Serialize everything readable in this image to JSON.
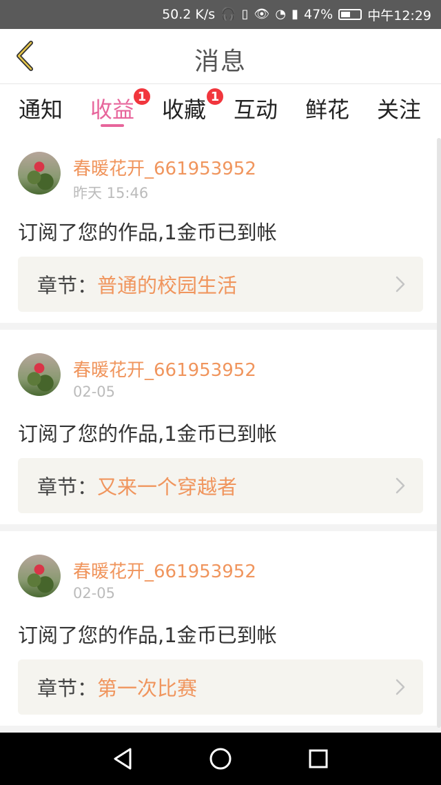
{
  "status_bar": {
    "network_speed": "50.2 K/s",
    "battery": "47%",
    "time": "中午12:29"
  },
  "header": {
    "title": "消息"
  },
  "tabs": [
    {
      "label": "通知",
      "badge": ""
    },
    {
      "label": "收益",
      "badge": "1"
    },
    {
      "label": "收藏",
      "badge": "1"
    },
    {
      "label": "互动",
      "badge": ""
    },
    {
      "label": "鲜花",
      "badge": ""
    },
    {
      "label": "关注",
      "badge": ""
    }
  ],
  "active_tab": "收益",
  "colors": {
    "accent_pink": "#e7659b",
    "name_orange": "#f0955d",
    "badge_red": "#f1363d"
  },
  "messages": [
    {
      "username": "春暖花开_661953952",
      "time": "昨天 15:46",
      "text": "订阅了您的作品,1金币已到帐",
      "chapter_prefix": "章节：",
      "chapter_name": "普通的校园生活"
    },
    {
      "username": "春暖花开_661953952",
      "time": "02-05",
      "text": "订阅了您的作品,1金币已到帐",
      "chapter_prefix": "章节：",
      "chapter_name": "又来一个穿越者"
    },
    {
      "username": "春暖花开_661953952",
      "time": "02-05",
      "text": "订阅了您的作品,1金币已到帐",
      "chapter_prefix": "章节：",
      "chapter_name": "第一次比赛"
    }
  ]
}
